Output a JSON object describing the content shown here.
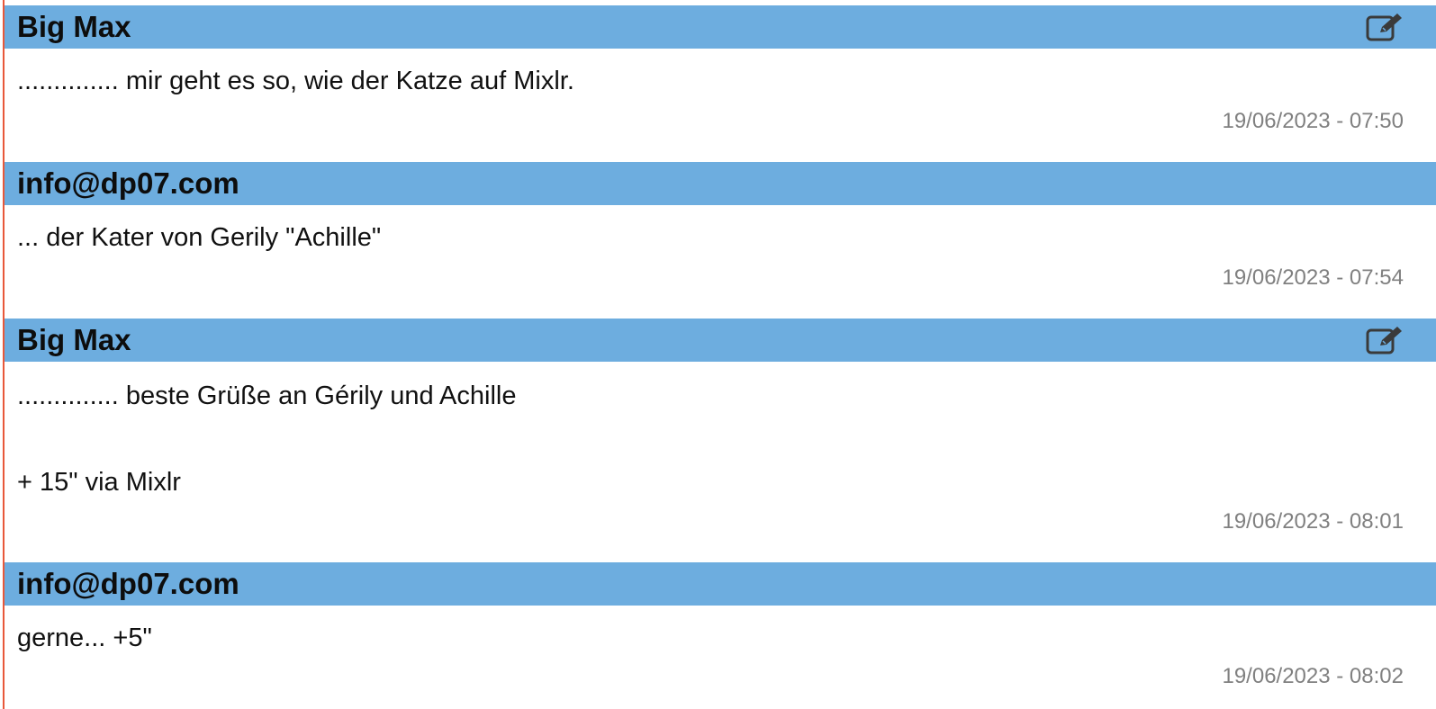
{
  "posts": [
    {
      "author": "Big Max",
      "editable": true,
      "lines": [
        ".............. mir geht es so, wie der Katze auf Mixlr."
      ],
      "timestamp": "19/06/2023 - 07:50"
    },
    {
      "author": "info@dp07.com",
      "editable": false,
      "lines": [
        "... der Kater von Gerily \"Achille\""
      ],
      "timestamp": "19/06/2023 - 07:54"
    },
    {
      "author": "Big Max",
      "editable": true,
      "lines": [
        ".............. beste Grüße an Gérily und Achille",
        "+ 15\" via Mixlr"
      ],
      "timestamp": "19/06/2023 - 08:01"
    },
    {
      "author": "info@dp07.com",
      "editable": false,
      "lines": [
        "gerne... +5\""
      ],
      "timestamp": "19/06/2023 - 08:02"
    }
  ],
  "colors": {
    "header_bg": "#6daddf",
    "left_rule": "#e8583a",
    "timestamp": "#808080",
    "icon": "#3a3a3a"
  },
  "icons": {
    "edit": "edit-pencil-icon"
  }
}
